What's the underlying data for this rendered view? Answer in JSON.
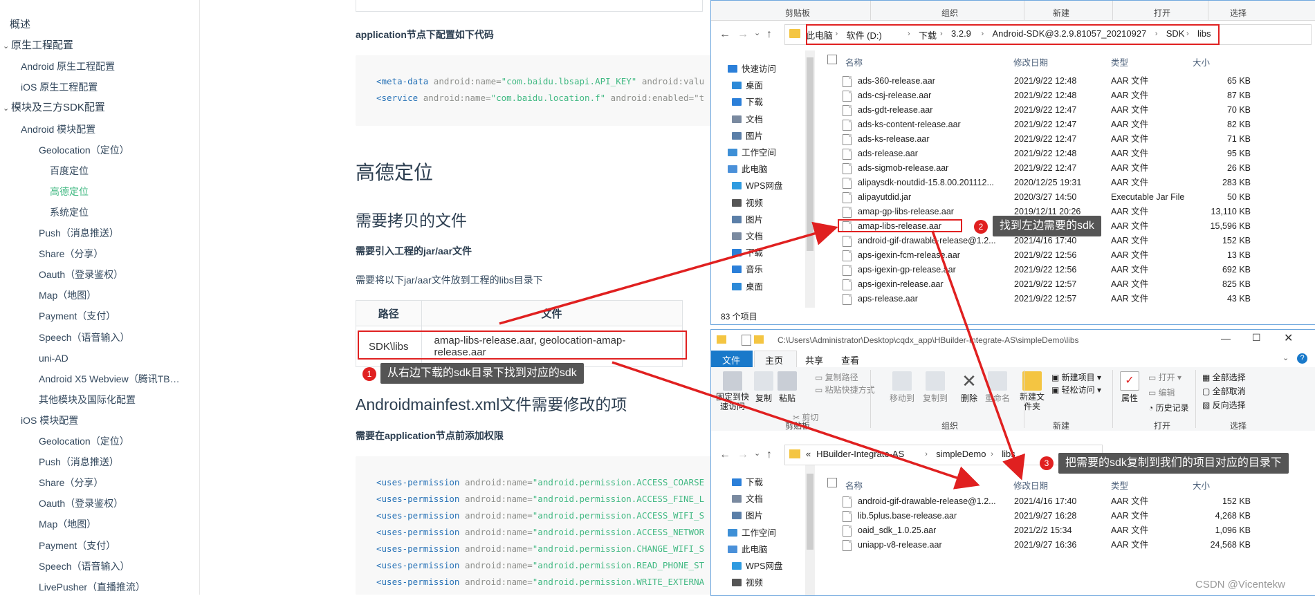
{
  "sidebar": {
    "items": [
      {
        "label": "概述",
        "level": 0
      },
      {
        "label": "原生工程配置",
        "level": 0,
        "caret": true
      },
      {
        "label": "Android 原生工程配置",
        "level": 1
      },
      {
        "label": "iOS 原生工程配置",
        "level": 1
      },
      {
        "label": "模块及三方SDK配置",
        "level": 0,
        "caret": true
      },
      {
        "label": "Android 模块配置",
        "level": 1
      },
      {
        "label": "Geolocation（定位）",
        "level": 2
      },
      {
        "label": "百度定位",
        "level": 3
      },
      {
        "label": "高德定位",
        "level": 3,
        "active": true
      },
      {
        "label": "系统定位",
        "level": 3
      },
      {
        "label": "Push（消息推送）",
        "level": 2
      },
      {
        "label": "Share（分享）",
        "level": 2
      },
      {
        "label": "Oauth（登录鉴权）",
        "level": 2
      },
      {
        "label": "Map（地图）",
        "level": 2
      },
      {
        "label": "Payment（支付）",
        "level": 2
      },
      {
        "label": "Speech（语音输入）",
        "level": 2
      },
      {
        "label": "uni-AD",
        "level": 2
      },
      {
        "label": "Android X5 Webview（腾讯TB…",
        "level": 2
      },
      {
        "label": "其他模块及国际化配置",
        "level": 2
      },
      {
        "label": "iOS 模块配置",
        "level": 1
      },
      {
        "label": "Geolocation（定位）",
        "level": 2
      },
      {
        "label": "Push（消息推送）",
        "level": 2
      },
      {
        "label": "Share（分享）",
        "level": 2
      },
      {
        "label": "Oauth（登录鉴权）",
        "level": 2
      },
      {
        "label": "Map（地图）",
        "level": 2
      },
      {
        "label": "Payment（支付）",
        "level": 2
      },
      {
        "label": "Speech（语音输入）",
        "level": 2
      },
      {
        "label": "LivePusher（直播推流）",
        "level": 2
      }
    ]
  },
  "doc": {
    "app_node_label": "application节点下配置如下代码",
    "code1": [
      {
        "tag": "<meta-data",
        "attr": " android:name=",
        "val": "\"com.baidu.lbsapi.API_KEY\"",
        "rest": " android:valu"
      },
      {
        "tag": "<service",
        "attr": " android:name=",
        "val": "\"com.baidu.location.f\"",
        "rest": " android:enabled=\"t"
      }
    ],
    "h2_amap": "高德定位",
    "h3_copy": "需要拷贝的文件",
    "h4_jar": "需要引入工程的jar/aar文件",
    "p_libs": "需要将以下jar/aar文件放到工程的libs目录下",
    "table": {
      "headers": [
        "路径",
        "文件"
      ],
      "path": "SDK\\libs",
      "files": "amap-libs-release.aar, geolocation-amap-release.aar"
    },
    "h3_manifest": "Androidmainfest.xml文件需要修改的项",
    "h4_perm": "需要在application节点前添加权限",
    "perm_tag": "<uses-permission",
    "perm_attr": " android:name=",
    "perm_lines": [
      "\"android.permission.ACCESS_COARSE",
      "\"android.permission.ACCESS_FINE_L",
      "\"android.permission.ACCESS_WIFI_S",
      "\"android.permission.ACCESS_NETWOR",
      "\"android.permission.CHANGE_WIFI_S",
      "\"android.permission.READ_PHONE_ST",
      "\"android.permission.WRITE_EXTERNA"
    ]
  },
  "callouts": [
    {
      "num": "1",
      "text": "从右边下载的sdk目录下找到对应的sdk"
    },
    {
      "num": "2",
      "text": "找到左边需要的sdk"
    },
    {
      "num": "3",
      "text": "把需要的sdk复制到我们的项目对应的目录下"
    }
  ],
  "explorer_top": {
    "ribbon_groups": [
      "剪贴板",
      "组织",
      "新建",
      "打开",
      "选择"
    ],
    "breadcrumbs": [
      "此电脑",
      "软件 (D:)",
      "下载",
      "3.2.9",
      "Android-SDK@3.2.9.81057_20210927",
      "SDK",
      "libs"
    ],
    "nav": [
      {
        "label": "快速访问",
        "icon": "star-icon"
      },
      {
        "label": "桌面",
        "icon": "desktop-icon"
      },
      {
        "label": "下载",
        "icon": "download-icon"
      },
      {
        "label": "文档",
        "icon": "document-icon"
      },
      {
        "label": "图片",
        "icon": "picture-icon"
      },
      {
        "label": "工作空间",
        "icon": "workspace-icon"
      },
      {
        "label": "此电脑",
        "icon": "computer-icon"
      },
      {
        "label": "WPS网盘",
        "icon": "cloud-icon"
      },
      {
        "label": "视频",
        "icon": "video-icon"
      },
      {
        "label": "图片",
        "icon": "picture-icon"
      },
      {
        "label": "文档",
        "icon": "document-icon"
      },
      {
        "label": "下载",
        "icon": "download-icon"
      },
      {
        "label": "音乐",
        "icon": "music-icon"
      },
      {
        "label": "桌面",
        "icon": "desktop-icon"
      }
    ],
    "columns": [
      "名称",
      "修改日期",
      "类型",
      "大小"
    ],
    "files": [
      {
        "name": "ads-360-release.aar",
        "date": "2021/9/22 12:48",
        "type": "AAR 文件",
        "size": "65 KB"
      },
      {
        "name": "ads-csj-release.aar",
        "date": "2021/9/22 12:48",
        "type": "AAR 文件",
        "size": "87 KB"
      },
      {
        "name": "ads-gdt-release.aar",
        "date": "2021/9/22 12:47",
        "type": "AAR 文件",
        "size": "70 KB"
      },
      {
        "name": "ads-ks-content-release.aar",
        "date": "2021/9/22 12:47",
        "type": "AAR 文件",
        "size": "82 KB"
      },
      {
        "name": "ads-ks-release.aar",
        "date": "2021/9/22 12:47",
        "type": "AAR 文件",
        "size": "71 KB"
      },
      {
        "name": "ads-release.aar",
        "date": "2021/9/22 12:48",
        "type": "AAR 文件",
        "size": "95 KB"
      },
      {
        "name": "ads-sigmob-release.aar",
        "date": "2021/9/22 12:47",
        "type": "AAR 文件",
        "size": "26 KB"
      },
      {
        "name": "alipaysdk-noutdid-15.8.00.201112...",
        "date": "2020/12/25 19:31",
        "type": "AAR 文件",
        "size": "283 KB"
      },
      {
        "name": "alipayutdid.jar",
        "date": "2020/3/27 14:50",
        "type": "Executable Jar File",
        "size": "50 KB"
      },
      {
        "name": "amap-gp-libs-release.aar",
        "date": "2019/12/11 20:26",
        "type": "AAR 文件",
        "size": "13,110 KB"
      },
      {
        "name": "amap-libs-release.aar",
        "date": "2021/9/22 12:47",
        "type": "AAR 文件",
        "size": "15,596 KB"
      },
      {
        "name": "android-gif-drawable-release@1.2...",
        "date": "2021/4/16 17:40",
        "type": "AAR 文件",
        "size": "152 KB"
      },
      {
        "name": "aps-igexin-fcm-release.aar",
        "date": "2021/9/22 12:56",
        "type": "AAR 文件",
        "size": "13 KB"
      },
      {
        "name": "aps-igexin-gp-release.aar",
        "date": "2021/9/22 12:56",
        "type": "AAR 文件",
        "size": "692 KB"
      },
      {
        "name": "aps-igexin-release.aar",
        "date": "2021/9/22 12:57",
        "type": "AAR 文件",
        "size": "825 KB"
      },
      {
        "name": "aps-release.aar",
        "date": "2021/9/22 12:57",
        "type": "AAR 文件",
        "size": "43 KB"
      }
    ],
    "status": "83 个项目"
  },
  "explorer_bottom": {
    "title": "C:\\Users\\Administrator\\Desktop\\cqdx_app\\HBuilder-Integrate-AS\\simpleDemo\\libs",
    "tabs": [
      "文件",
      "主页",
      "共享",
      "查看"
    ],
    "ribbon": {
      "pin": "固定到快速访问",
      "copy": "复制",
      "paste": "粘贴",
      "copy_path": "复制路径",
      "paste_shortcut": "粘贴快捷方式",
      "cut": "剪切",
      "move_to": "移动到",
      "copy_to": "复制到",
      "delete": "删除",
      "rename": "重命名",
      "new_folder": "新建文件夹",
      "new_item": "新建项目",
      "easy_access": "轻松访问",
      "properties": "属性",
      "open": "打开",
      "edit": "编辑",
      "history": "历史记录",
      "select_all": "全部选择",
      "select_none": "全部取消",
      "invert": "反向选择"
    },
    "ribbon_groups": [
      "剪贴板",
      "组织",
      "新建",
      "打开",
      "选择"
    ],
    "breadcrumbs": [
      "«",
      "HBuilder-Integrate-AS",
      "simpleDemo",
      "libs"
    ],
    "nav": [
      {
        "label": "下载",
        "icon": "download-icon"
      },
      {
        "label": "文档",
        "icon": "document-icon"
      },
      {
        "label": "图片",
        "icon": "picture-icon"
      },
      {
        "label": "工作空间",
        "icon": "workspace-icon"
      },
      {
        "label": "此电脑",
        "icon": "computer-icon"
      },
      {
        "label": "WPS网盘",
        "icon": "cloud-icon"
      },
      {
        "label": "视频",
        "icon": "video-icon"
      }
    ],
    "columns": [
      "名称",
      "修改日期",
      "类型",
      "大小"
    ],
    "files": [
      {
        "name": "android-gif-drawable-release@1.2...",
        "date": "2021/4/16 17:40",
        "type": "AAR 文件",
        "size": "152 KB"
      },
      {
        "name": "lib.5plus.base-release.aar",
        "date": "2021/9/27 16:28",
        "type": "AAR 文件",
        "size": "4,268 KB"
      },
      {
        "name": "oaid_sdk_1.0.25.aar",
        "date": "2021/2/2 15:34",
        "type": "AAR 文件",
        "size": "1,096 KB"
      },
      {
        "name": "uniapp-v8-release.aar",
        "date": "2021/9/27 16:36",
        "type": "AAR 文件",
        "size": "24,568 KB"
      }
    ]
  },
  "watermark": "CSDN @Vicentekw",
  "colors": {
    "accent_green": "#42b983",
    "red": "#e02020",
    "callout_bg": "#555555",
    "win_title": "#0078d7"
  }
}
